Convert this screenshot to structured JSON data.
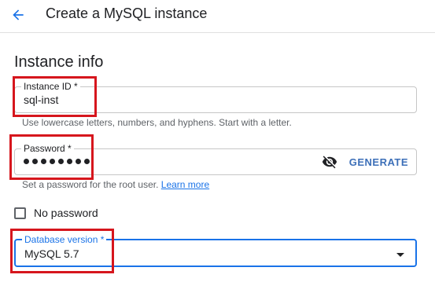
{
  "header": {
    "title": "Create a MySQL instance",
    "back_icon": "arrow-back-icon"
  },
  "section": {
    "title": "Instance info"
  },
  "instance_id": {
    "label": "Instance ID *",
    "value": "sql-inst",
    "helper": "Use lowercase letters, numbers, and hyphens. Start with a letter."
  },
  "password": {
    "label": "Password *",
    "value_masked_length": 8,
    "visibility_icon": "visibility-off-icon",
    "generate_label": "GENERATE",
    "helper": "Set a password for the root user.",
    "learn_more": "Learn more"
  },
  "no_password": {
    "label": "No password",
    "checked": false
  },
  "database_version": {
    "label": "Database version *",
    "value": "MySQL 5.7"
  },
  "colors": {
    "accent": "#1a73e8",
    "highlight": "#d6161d"
  }
}
